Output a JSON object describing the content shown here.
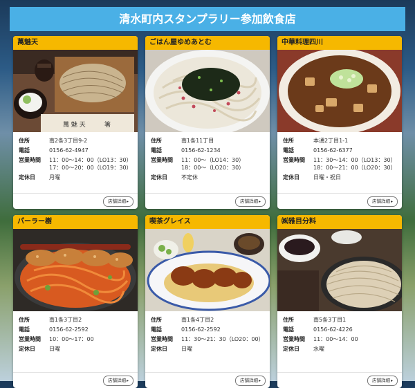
{
  "banner": {
    "title": "清水町内スタンプラリー参加飲食店"
  },
  "labels": {
    "address": "住所",
    "phone": "電話",
    "hours": "営業時間",
    "closed": "定休日",
    "detail_button": "店舗詳細",
    "arrow": "▸"
  },
  "cards": [
    {
      "name": "萬魅天",
      "address": "南2条3丁目9-2",
      "phone": "0156-62-4947",
      "hours": [
        "11：00〜14：00（LO13：30）",
        "17：00〜20：00（LO19：30）"
      ],
      "closed": "月曜",
      "photo": "soba-plate-photo"
    },
    {
      "name": "ごはん屋ゆめあとむ",
      "address": "南1条11丁目",
      "phone": "0156-62-1234",
      "hours": [
        "11：00〜（LO14：30）",
        "18：00〜（LO20：30）"
      ],
      "closed": "不定休",
      "photo": "udon-bowl-photo"
    },
    {
      "name": "中華料理四川",
      "address": "本通2丁目1-1",
      "phone": "0156-62-6377",
      "hours": [
        "11：30〜14：00（LO13：30）",
        "18：00〜21：00（LO20：30）"
      ],
      "closed": "日曜・祝日",
      "photo": "mapo-tofu-photo"
    },
    {
      "name": "パーラー樹",
      "address": "南1条3丁目2",
      "phone": "0156-62-2592",
      "hours": [
        "10：00〜17：00"
      ],
      "closed": "日曜",
      "photo": "napolitan-cutlet-photo"
    },
    {
      "name": "喫茶グレイス",
      "address": "南1条4丁目2",
      "phone": "0156-62-2592",
      "hours": [
        "11：30〜21：30（LO20：00）"
      ],
      "closed": "日曜",
      "photo": "cutlet-curry-plate-photo"
    },
    {
      "name": "㈱雅目分料",
      "address": "南5条3丁目1",
      "phone": "0156-62-4226",
      "hours": [
        "11：00〜14：00"
      ],
      "closed": "水曜",
      "photo": "zaru-soba-photo"
    }
  ]
}
